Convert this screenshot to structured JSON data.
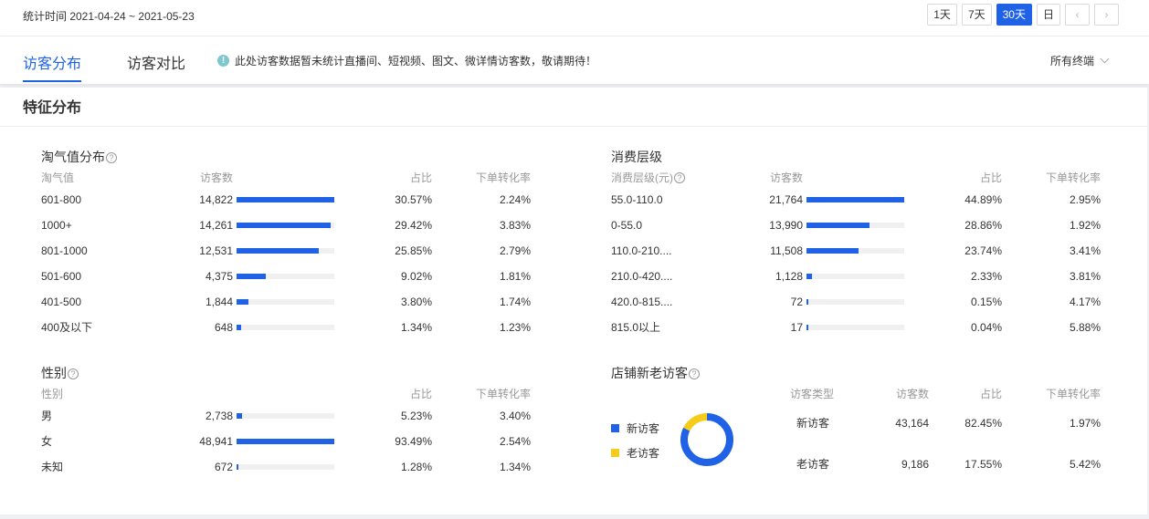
{
  "header": {
    "stat_time_label": "统计时间 2021-04-24 ~ 2021-05-23",
    "range_buttons": [
      "1天",
      "7天",
      "30天",
      "日"
    ],
    "active_range": "30天",
    "prev_icon": "‹",
    "next_icon": "›"
  },
  "tabs": {
    "items": [
      "访客分布",
      "访客对比"
    ],
    "active": "访客分布",
    "notice": "此处访客数据暂未统计直播间、短视频、图文、微详情访客数，敬请期待！",
    "terminal_select": "所有终端"
  },
  "section": {
    "title": "特征分布"
  },
  "taoqi": {
    "title": "淘气值分布",
    "headers": [
      "淘气值",
      "访客数",
      "占比",
      "下单转化率"
    ],
    "rows": [
      {
        "label": "601-800",
        "visitors": "14,822",
        "share": "30.57%",
        "conv": "2.24%",
        "level": 1.0
      },
      {
        "label": "1000+",
        "visitors": "14,261",
        "share": "29.42%",
        "conv": "3.83%",
        "level": 0.962
      },
      {
        "label": "801-1000",
        "visitors": "12,531",
        "share": "25.85%",
        "conv": "2.79%",
        "level": 0.845
      },
      {
        "label": "501-600",
        "visitors": "4,375",
        "share": "9.02%",
        "conv": "1.81%",
        "level": 0.295
      },
      {
        "label": "401-500",
        "visitors": "1,844",
        "share": "3.80%",
        "conv": "1.74%",
        "level": 0.124
      },
      {
        "label": "400及以下",
        "visitors": "648",
        "share": "1.34%",
        "conv": "1.23%",
        "level": 0.044
      }
    ]
  },
  "consume": {
    "title": "消费层级",
    "headers": [
      "消费层级(元)",
      "访客数",
      "占比",
      "下单转化率"
    ],
    "rows": [
      {
        "label": "55.0-110.0",
        "visitors": "21,764",
        "share": "44.89%",
        "conv": "2.95%",
        "level": 1.0
      },
      {
        "label": "0-55.0",
        "visitors": "13,990",
        "share": "28.86%",
        "conv": "1.92%",
        "level": 0.643
      },
      {
        "label": "110.0-210....",
        "visitors": "11,508",
        "share": "23.74%",
        "conv": "3.41%",
        "level": 0.529
      },
      {
        "label": "210.0-420....",
        "visitors": "1,128",
        "share": "2.33%",
        "conv": "3.81%",
        "level": 0.052
      },
      {
        "label": "420.0-815....",
        "visitors": "72",
        "share": "0.15%",
        "conv": "4.17%",
        "level": 0.003
      },
      {
        "label": "815.0以上",
        "visitors": "17",
        "share": "0.04%",
        "conv": "5.88%",
        "level": 0.001
      }
    ]
  },
  "gender": {
    "title": "性别",
    "headers": [
      "性别",
      "占比",
      "下单转化率"
    ],
    "rows": [
      {
        "label": "男",
        "visitors": "2,738",
        "share": "5.23%",
        "conv": "3.40%",
        "level": 0.056
      },
      {
        "label": "女",
        "visitors": "48,941",
        "share": "93.49%",
        "conv": "2.54%",
        "level": 1.0
      },
      {
        "label": "未知",
        "visitors": "672",
        "share": "1.28%",
        "conv": "1.34%",
        "level": 0.014
      }
    ]
  },
  "newold": {
    "title": "店铺新老访客",
    "headers": [
      "访客类型",
      "访客数",
      "占比",
      "下单转化率"
    ],
    "legend": [
      {
        "name": "新访客",
        "color": "#2062e6"
      },
      {
        "name": "老访客",
        "color": "#f5cc1b"
      }
    ],
    "rows": [
      {
        "label": "新访客",
        "visitors": "43,164",
        "share": "82.45%",
        "conv": "1.97%",
        "fraction": 0.8245
      },
      {
        "label": "老访客",
        "visitors": "9,186",
        "share": "17.55%",
        "conv": "5.42%",
        "fraction": 0.1755
      }
    ]
  }
}
